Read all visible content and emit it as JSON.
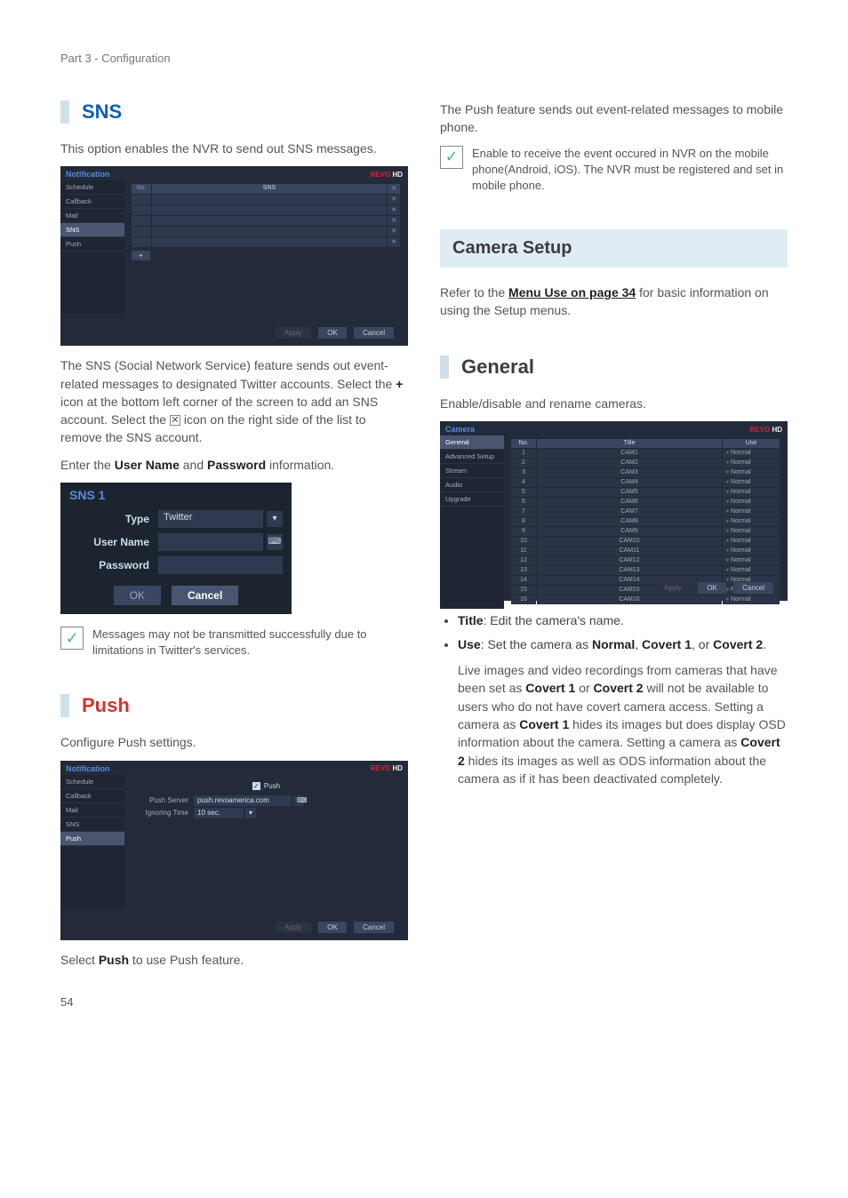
{
  "breadcrumb": "Part 3 - Configuration",
  "page_number": "54",
  "left": {
    "sns": {
      "heading": "SNS",
      "intro": "This option enables the NVR to send out SNS messages.",
      "app": {
        "section": "Notification",
        "brand": "REVO",
        "brand_sub": "HD",
        "side_items": [
          "Schedule",
          "Callback",
          "Mail",
          "SNS",
          "Push"
        ],
        "active_side": "SNS",
        "header_no": "No.",
        "header_sns": "SNS",
        "row_count": 5,
        "plus": "+",
        "btn_apply": "Apply",
        "btn_ok": "OK",
        "btn_cancel": "Cancel"
      },
      "desc1_a": "The SNS (Social Network Service) feature sends out event-related messages to designated Twitter accounts. Select the ",
      "desc1_plus": "+",
      "desc1_b": " icon at the bottom left corner of the screen to add an SNS account. Select the ",
      "desc1_c": " icon on the right side of the list to remove the SNS account.",
      "desc2_a": "Enter the ",
      "desc2_user": "User Name",
      "desc2_and": " and ",
      "desc2_pass": "Password",
      "desc2_b": " information.",
      "dialog": {
        "title": "SNS 1",
        "type_label": "Type",
        "type_value": "Twitter",
        "user_label": "User Name",
        "pass_label": "Password",
        "ok": "OK",
        "cancel": "Cancel"
      },
      "tip": "Messages may not be transmitted successfully due to limitations in Twitter's services."
    },
    "push": {
      "heading": "Push",
      "intro": "Configure Push settings.",
      "app": {
        "section": "Notification",
        "brand": "REVO",
        "brand_sub": "HD",
        "side_items": [
          "Schedule",
          "Callback",
          "Mail",
          "SNS",
          "Push"
        ],
        "active_side": "Push",
        "check_label": "Push",
        "server_label": "Push Server",
        "server_value": "push.revoamerica.com",
        "ignore_label": "Ignoring Time",
        "ignore_value": "10 sec.",
        "btn_apply": "Apply",
        "btn_ok": "OK",
        "btn_cancel": "Cancel"
      },
      "desc_a": "Select ",
      "desc_push": "Push",
      "desc_b": " to use Push feature."
    }
  },
  "right": {
    "push_top": "The Push feature sends out event-related messages to mobile phone.",
    "push_tip": "Enable to receive the event occured in NVR on the mobile phone(Android, iOS). The NVR must be registered and set in mobile phone.",
    "camera_setup_heading": "Camera Setup",
    "camera_setup_a": "Refer to the ",
    "camera_setup_link": "Menu Use on page 34",
    "camera_setup_b": " for basic information on using the Setup menus.",
    "general": {
      "heading": "General",
      "intro": "Enable/disable and rename cameras.",
      "app": {
        "section": "Camera",
        "brand": "REVO",
        "brand_sub": "HD",
        "side_items": [
          "General",
          "Advanced Setup",
          "Stream",
          "Audio",
          "Upgrade"
        ],
        "active_side": "General",
        "col_no": "No.",
        "col_title": "Title",
        "col_use": "Use",
        "rows": [
          {
            "no": "1",
            "title": "CAM1",
            "use": "Normal"
          },
          {
            "no": "2",
            "title": "CAM2",
            "use": "Normal"
          },
          {
            "no": "3",
            "title": "CAM3",
            "use": "Normal"
          },
          {
            "no": "4",
            "title": "CAM4",
            "use": "Normal"
          },
          {
            "no": "5",
            "title": "CAM5",
            "use": "Normal"
          },
          {
            "no": "6",
            "title": "CAM6",
            "use": "Normal"
          },
          {
            "no": "7",
            "title": "CAM7",
            "use": "Normal"
          },
          {
            "no": "8",
            "title": "CAM8",
            "use": "Normal"
          },
          {
            "no": "9",
            "title": "CAM9",
            "use": "Normal"
          },
          {
            "no": "10",
            "title": "CAM10",
            "use": "Normal"
          },
          {
            "no": "11",
            "title": "CAM11",
            "use": "Normal"
          },
          {
            "no": "12",
            "title": "CAM12",
            "use": "Normal"
          },
          {
            "no": "13",
            "title": "CAM13",
            "use": "Normal"
          },
          {
            "no": "14",
            "title": "CAM14",
            "use": "Normal"
          },
          {
            "no": "15",
            "title": "CAM15",
            "use": "Normal"
          },
          {
            "no": "16",
            "title": "CAM16",
            "use": "Normal"
          }
        ],
        "btn_apply": "Apply",
        "btn_ok": "OK",
        "btn_cancel": "Cancel"
      },
      "bullet_title_label": "Title",
      "bullet_title_text": ": Edit the camera's name.",
      "bullet_use_label": "Use",
      "bullet_use_a": ": Set the camera as ",
      "bullet_use_normal": "Normal",
      "bullet_use_comma1": ", ",
      "bullet_use_c1": "Covert 1",
      "bullet_use_or": ", or ",
      "bullet_use_c2": "Covert 2",
      "bullet_use_dot": ".",
      "use_p_a": "Live images and video recordings from cameras that have been set as ",
      "use_p_c1": "Covert 1",
      "use_p_b": " or ",
      "use_p_c2": "Covert 2",
      "use_p_c": " will not be available to users who do not have covert camera access. Setting a camera as ",
      "use_p_c1b": "Covert 1",
      "use_p_d": " hides its images but does display OSD information about the camera. Setting a camera as ",
      "use_p_c2b": "Covert 2",
      "use_p_e": " hides its images as well as ODS information about the camera as if it has been deactivated completely."
    }
  }
}
